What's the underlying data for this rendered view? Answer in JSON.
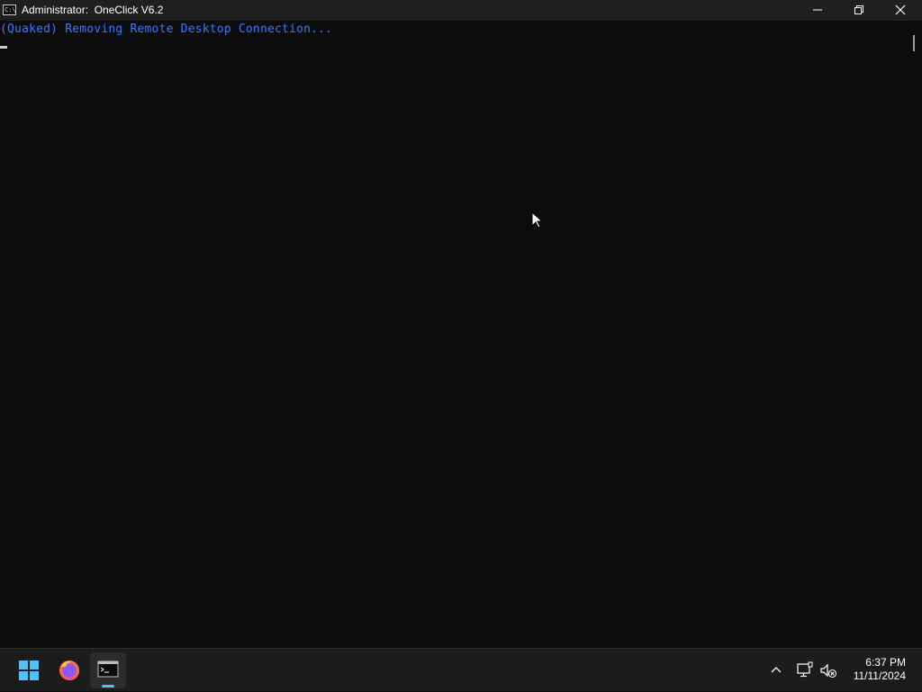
{
  "window": {
    "title": "Administrator:  OneClick V6.2",
    "app_icon_glyph": "C:\\",
    "buttons": {
      "minimize": "minimize-icon",
      "maximize": "restore-icon",
      "close": "close-icon"
    }
  },
  "console": {
    "lines": [
      "(Quaked) Removing Remote Desktop Connection..."
    ],
    "text_color": "#3b78ff",
    "background": "#0c0c0c"
  },
  "taskbar": {
    "apps": [
      {
        "name": "Start",
        "icon": "windows-start-icon"
      },
      {
        "name": "Firefox",
        "icon": "firefox-icon"
      },
      {
        "name": "Command Prompt",
        "icon": "terminal-icon",
        "active": true
      }
    ],
    "tray": {
      "chevron": "chevron-up-icon",
      "network": "network-icon",
      "volume": "volume-muted-icon"
    },
    "clock": {
      "time": "6:37 PM",
      "date": "11/11/2024"
    },
    "accent": "#4cc2ff"
  }
}
